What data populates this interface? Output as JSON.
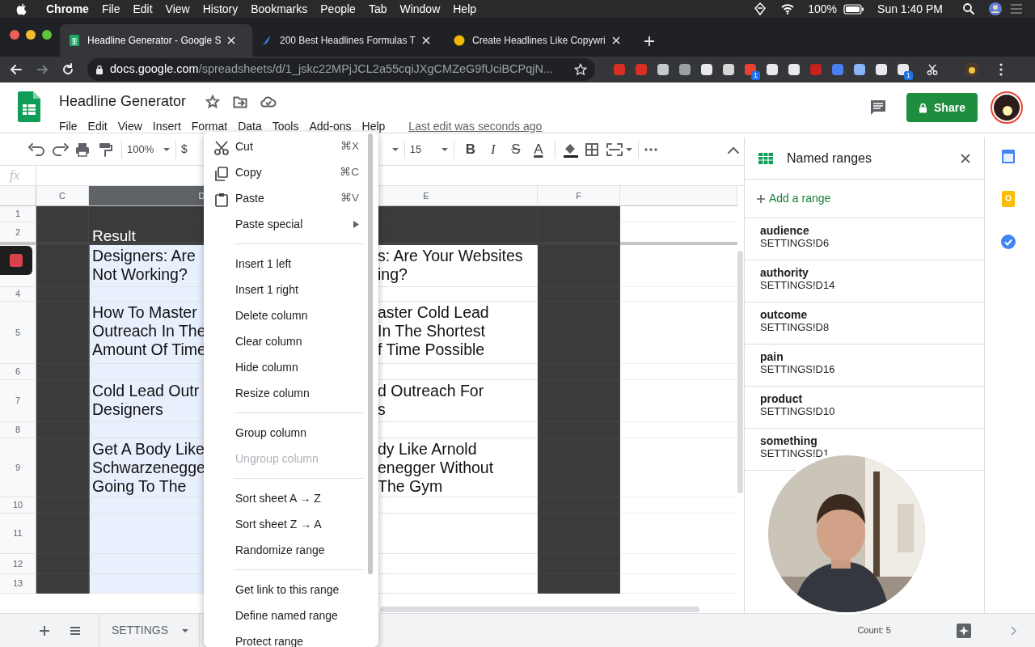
{
  "mac_menubar": {
    "app": "Chrome",
    "menus": [
      "File",
      "Edit",
      "View",
      "History",
      "Bookmarks",
      "People",
      "Tab",
      "Window",
      "Help"
    ],
    "battery": "100%",
    "clock": "Sun 1:40 PM"
  },
  "browser": {
    "tabs": [
      {
        "title": "Headline Generator - Google S",
        "selected": true
      },
      {
        "title": "200 Best Headlines Formulas T",
        "selected": false
      },
      {
        "title": "Create Headlines Like Copywri",
        "selected": false
      }
    ],
    "address": {
      "host": "docs.google.com",
      "path": "/spreadsheets/d/1_jskc22MPjJCL2a55cqiJXgCMZeG9fUciBCPqjN..."
    },
    "extensions": [
      {
        "kind": "extension"
      },
      {
        "kind": "extension"
      },
      {
        "kind": "extension"
      },
      {
        "kind": "extension"
      },
      {
        "kind": "extension"
      },
      {
        "kind": "extension"
      },
      {
        "kind": "extension",
        "badge": "1"
      },
      {
        "kind": "extension"
      },
      {
        "kind": "extension"
      },
      {
        "kind": "extension"
      },
      {
        "kind": "extension"
      },
      {
        "kind": "extension"
      },
      {
        "kind": "extension"
      },
      {
        "kind": "extension",
        "badge": "1"
      }
    ]
  },
  "sheets": {
    "title": "Headline Generator",
    "menus": [
      "File",
      "Edit",
      "View",
      "Insert",
      "Format",
      "Data",
      "Tools",
      "Add-ons",
      "Help"
    ],
    "last_edit": "Last edit was seconds ago",
    "share": "Share"
  },
  "toolbar": {
    "zoom": "100%",
    "currency": "$",
    "font_size": "15",
    "format_buttons": [
      "B",
      "I",
      "S",
      "A"
    ]
  },
  "formula_bar": {
    "label": "fx"
  },
  "grid": {
    "columns": [
      {
        "label": "C",
        "selected": false,
        "shaded": true
      },
      {
        "label": "D",
        "selected": true,
        "shaded": false
      },
      {
        "label": "E",
        "selected": false,
        "shaded": false
      },
      {
        "label": "F",
        "selected": false,
        "shaded": true
      }
    ],
    "rows": [
      {
        "number": "1",
        "frozen": true,
        "kind": "blank"
      },
      {
        "number": "2",
        "frozen": true,
        "kind": "header",
        "text": "Result"
      },
      {
        "frozen": false,
        "kind": "headline",
        "text_left": [
          "Designers: Are",
          "Not Working?"
        ],
        "text_right": [
          "s: Are Your Websites",
          "ing?"
        ]
      },
      {
        "number": "4",
        "frozen": false,
        "kind": "blank"
      },
      {
        "number": "5",
        "frozen": false,
        "kind": "headline",
        "text_left": [
          "How To Master",
          "Outreach In The",
          "Amount Of Time"
        ],
        "text_right": [
          "aster Cold Lead",
          "In The Shortest",
          "f Time Possible"
        ]
      },
      {
        "number": "6",
        "frozen": false,
        "kind": "blank"
      },
      {
        "number": "7",
        "frozen": false,
        "kind": "headline",
        "text_left": [
          "Cold Lead Outr",
          "Designers"
        ],
        "text_right": [
          "d Outreach For",
          "s"
        ]
      },
      {
        "number": "8",
        "frozen": false,
        "kind": "blank"
      },
      {
        "number": "9",
        "frozen": false,
        "kind": "headline",
        "text_left": [
          "Get A Body Like",
          "Schwarzenegge",
          "Going To The"
        ],
        "text_right": [
          "dy Like Arnold",
          "enegger Without",
          "The Gym"
        ]
      },
      {
        "number": "10",
        "frozen": false,
        "kind": "blank"
      },
      {
        "number": "11",
        "frozen": false,
        "kind": "blank"
      },
      {
        "number": "12",
        "frozen": false,
        "kind": "blank"
      },
      {
        "number": "13",
        "frozen": false,
        "kind": "blank"
      }
    ]
  },
  "context_menu": {
    "items": [
      {
        "kind": "item",
        "label": "Cut",
        "shortcut": "⌘X",
        "disabled": false
      },
      {
        "kind": "item",
        "label": "Copy",
        "shortcut": "⌘C",
        "disabled": false
      },
      {
        "kind": "item",
        "label": "Paste",
        "shortcut": "⌘V",
        "disabled": false
      },
      {
        "kind": "item",
        "label": "Paste special",
        "submenu": true,
        "disabled": false
      },
      {
        "kind": "separator"
      },
      {
        "kind": "item",
        "label": "Insert 1 left",
        "disabled": false
      },
      {
        "kind": "item",
        "label": "Insert 1 right",
        "disabled": false
      },
      {
        "kind": "item",
        "label": "Delete column",
        "disabled": false
      },
      {
        "kind": "item",
        "label": "Clear column",
        "disabled": false
      },
      {
        "kind": "item",
        "label": "Hide column",
        "disabled": false
      },
      {
        "kind": "item",
        "label": "Resize column",
        "disabled": false
      },
      {
        "kind": "separator"
      },
      {
        "kind": "item",
        "label": "Group column",
        "disabled": false
      },
      {
        "kind": "item",
        "label": "Ungroup column",
        "disabled": true
      },
      {
        "kind": "separator"
      },
      {
        "kind": "item",
        "label": "Sort sheet A → Z",
        "disabled": false
      },
      {
        "kind": "item",
        "label": "Sort sheet Z → A",
        "disabled": false
      },
      {
        "kind": "item",
        "label": "Randomize range",
        "disabled": false
      },
      {
        "kind": "separator"
      },
      {
        "kind": "item",
        "label": "Get link to this range",
        "disabled": false
      },
      {
        "kind": "item",
        "label": "Define named range",
        "disabled": false
      },
      {
        "kind": "item",
        "label": "Protect range",
        "disabled": false
      }
    ]
  },
  "named_ranges": {
    "title": "Named ranges",
    "add": "Add a range",
    "ranges": [
      {
        "name": "audience",
        "range": "SETTINGS!D6"
      },
      {
        "name": "authority",
        "range": "SETTINGS!D14"
      },
      {
        "name": "outcome",
        "range": "SETTINGS!D8"
      },
      {
        "name": "pain",
        "range": "SETTINGS!D16"
      },
      {
        "name": "product",
        "range": "SETTINGS!D10"
      },
      {
        "name": "something",
        "range": "SETTINGS!D1"
      }
    ]
  },
  "sheet_tabs": {
    "tabs": [
      {
        "label": "SETTINGS"
      }
    ],
    "count": "Count: 5"
  }
}
